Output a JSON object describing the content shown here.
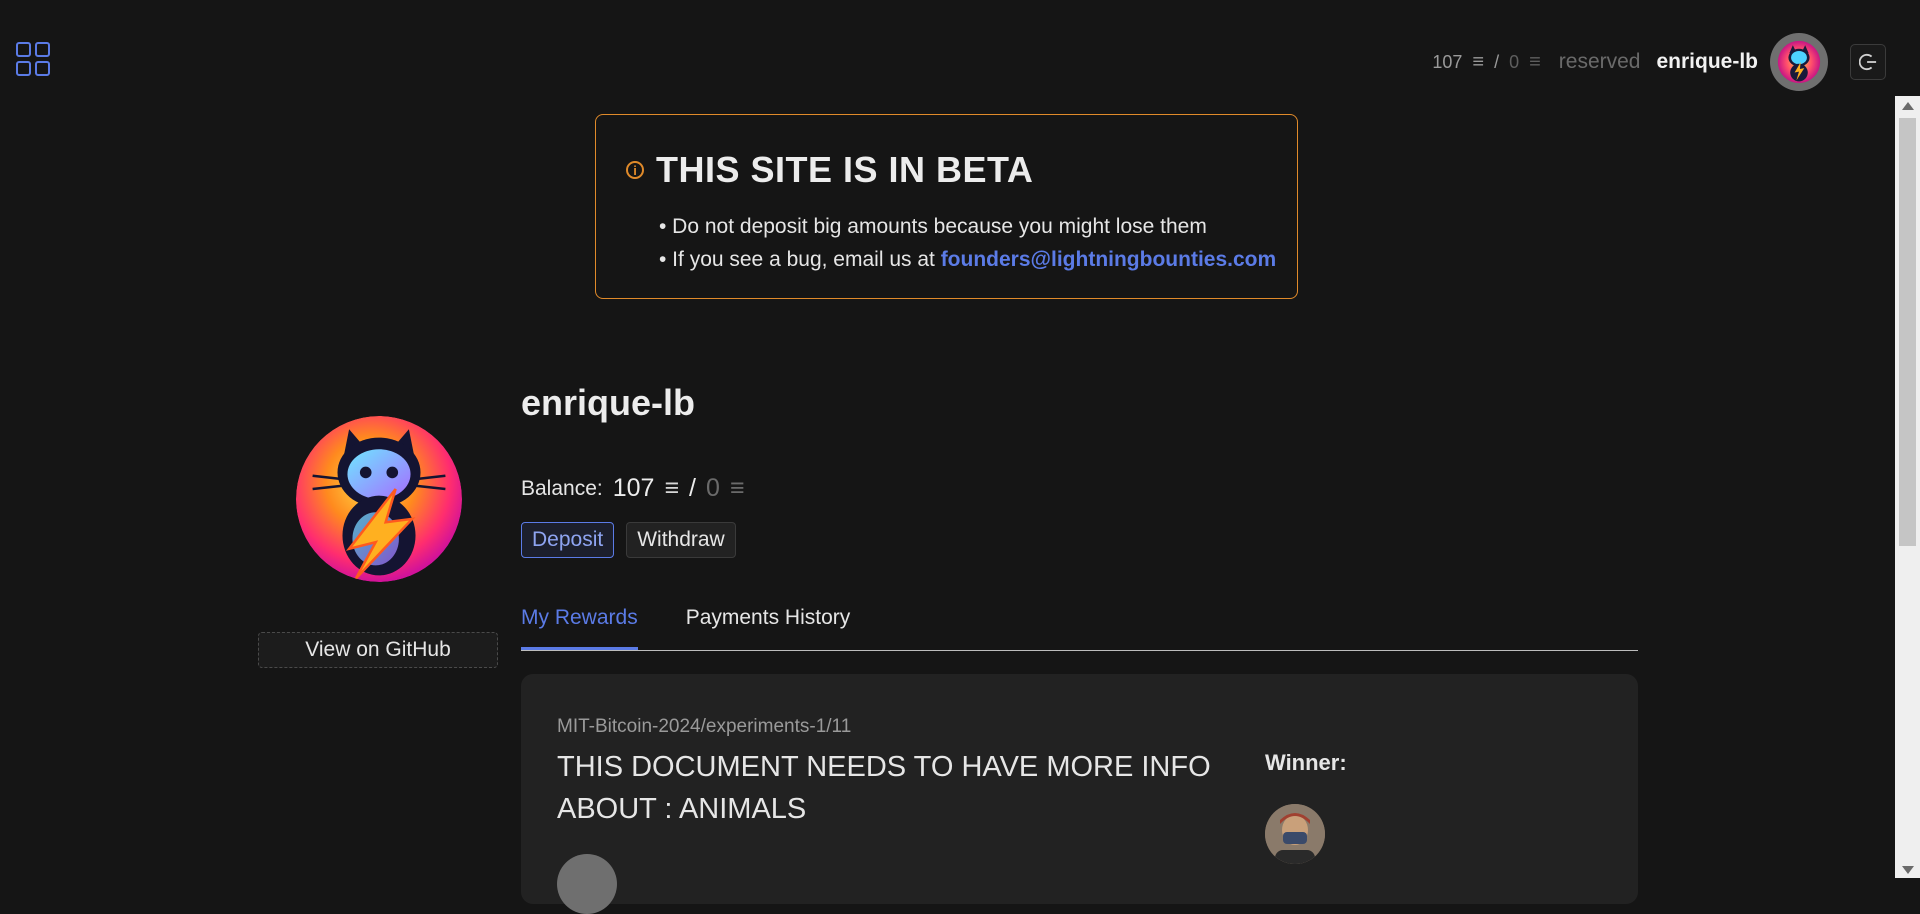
{
  "nav": {
    "apps_icon": "grid-icon"
  },
  "topbar": {
    "balance": "107",
    "reserved_amount": "0",
    "separator": "/",
    "reserved_label": "reserved",
    "username": "enrique-lb",
    "sat_symbol": "₿-sat-icon",
    "logout_icon": "logout-icon"
  },
  "beta_notice": {
    "title": "THIS SITE IS IN BETA",
    "line1": "• Do not deposit big amounts because you might lose them",
    "line2_prefix": "• If you see a bug, email us at ",
    "email": "founders@lightningbounties.com",
    "accent": "#e08a2a"
  },
  "profile": {
    "username": "enrique-lb",
    "balance_label": "Balance:",
    "balance": "107",
    "separator": "/",
    "reserved": "0",
    "deposit_label": "Deposit",
    "withdraw_label": "Withdraw",
    "github_label": "View on GitHub"
  },
  "tabs": [
    {
      "label": "My Rewards",
      "active": true
    },
    {
      "label": "Payments History",
      "active": false
    }
  ],
  "rewards": [
    {
      "repo": "MIT-Bitcoin-2024/experiments-1/11",
      "title": "THIS DOCUMENT NEEDS TO HAVE MORE INFO ABOUT : ANIMALS",
      "winner_label": "Winner:"
    }
  ],
  "colors": {
    "accent": "#5b7be6",
    "background": "#151515",
    "card": "#222222"
  }
}
